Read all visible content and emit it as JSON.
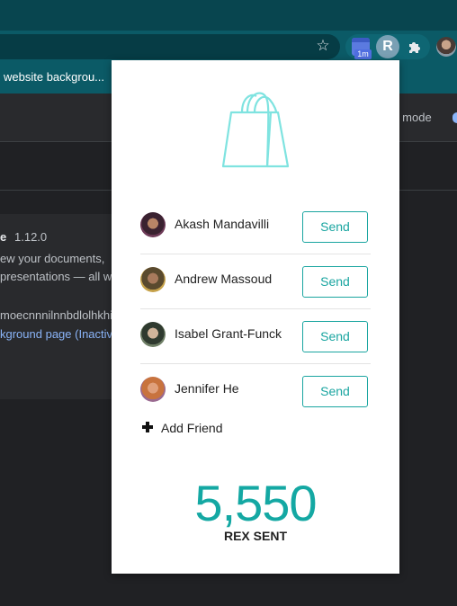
{
  "browser": {
    "bookmark_text": "website backgrou...",
    "extension_badge": "1m",
    "extension_r_label": "R"
  },
  "page": {
    "header_mode_text": "er mode",
    "card": {
      "title_fragment": "e",
      "version": "1.12.0",
      "line1": "ew your documents,",
      "line2": "presentations — all w",
      "extension_id_fragment": "moecnnnilnnbdlolhkhi",
      "link_fragment": "kground page (Inactive"
    }
  },
  "popup": {
    "friends": [
      {
        "name": "Akash Mandavilli",
        "send_label": "Send"
      },
      {
        "name": "Andrew Massoud",
        "send_label": "Send"
      },
      {
        "name": "Isabel Grant-Funck",
        "send_label": "Send"
      },
      {
        "name": "Jennifer He",
        "send_label": "Send"
      }
    ],
    "add_friend_label": "Add Friend",
    "total_value": "5,550",
    "total_label": "REX SENT"
  },
  "colors": {
    "accent": "#1aa5a0",
    "chrome": "#0b5a66",
    "bag_outline": "#7fe3e0"
  },
  "icons": {
    "bag": "shopping-bag-icon",
    "star": "star-icon",
    "puzzle": "puzzle-icon",
    "plus": "plus-icon"
  }
}
